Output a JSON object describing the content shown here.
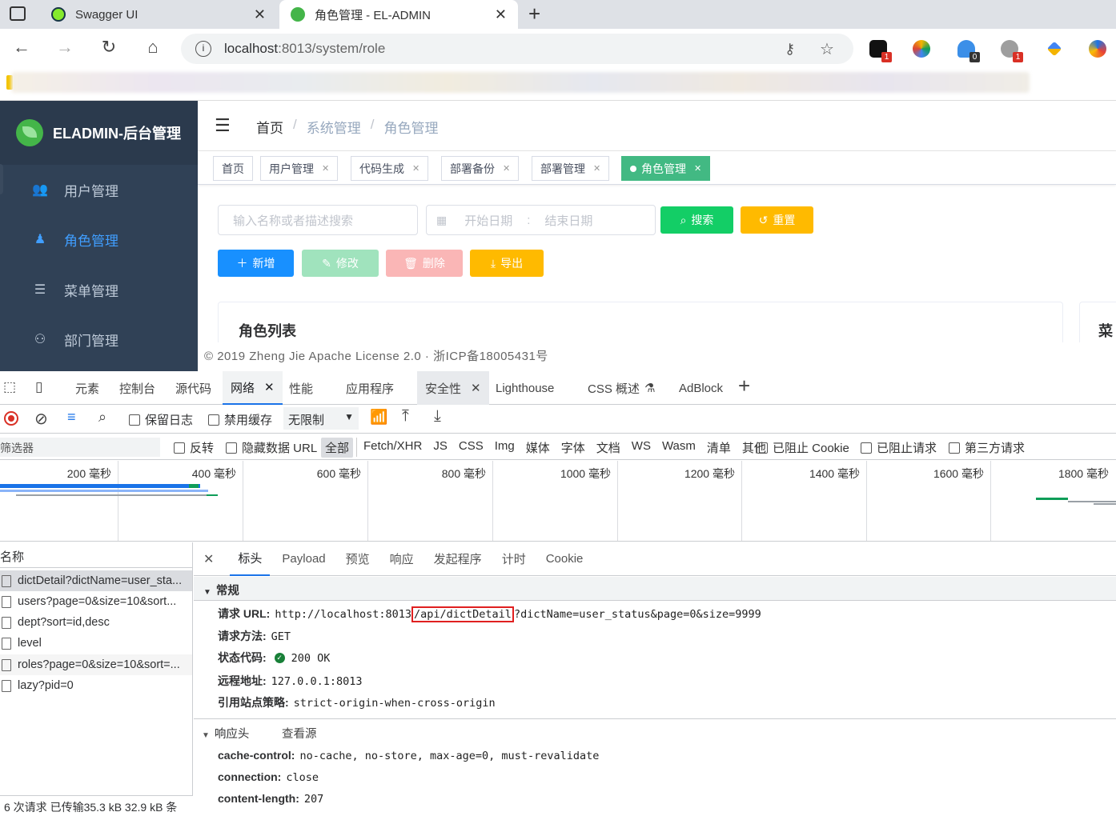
{
  "browser": {
    "tabs": [
      {
        "title": "Swagger UI"
      },
      {
        "title": "角色管理 - EL-ADMIN"
      }
    ],
    "url_host": "localhost",
    "url_path": ":8013/system/role",
    "extension_badges": [
      "1",
      "0",
      "1"
    ]
  },
  "app": {
    "logo_text": "ELADMIN-后台管理",
    "menu": [
      {
        "label": "用户管理"
      },
      {
        "label": "角色管理"
      },
      {
        "label": "菜单管理"
      },
      {
        "label": "部门管理"
      }
    ],
    "breadcrumb": [
      "首页",
      "系统管理",
      "角色管理"
    ],
    "tags": [
      "首页",
      "用户管理",
      "代码生成",
      "部署备份",
      "部署管理",
      "角色管理"
    ],
    "search_placeholder": "输入名称或者描述搜索",
    "start_date": "开始日期",
    "date_sep": ":",
    "end_date": "结束日期",
    "btn_search": "搜索",
    "btn_reset": "重置",
    "btn_add": "新增",
    "btn_edit": "修改",
    "btn_delete": "删除",
    "btn_export": "导出",
    "card_title": "角色列表",
    "card2_title": "菜",
    "footer": "© 2019 Zheng Jie Apache License 2.0 · 浙ICP备18005431号"
  },
  "devtools": {
    "tabs": [
      "元素",
      "控制台",
      "源代码",
      "网络",
      "性能",
      "应用程序",
      "安全性",
      "Lighthouse",
      "CSS 概述",
      "AdBlock"
    ],
    "toolbar": {
      "preserve_log": "保留日志",
      "disable_cache": "禁用缓存",
      "throttle": "无限制"
    },
    "filter": {
      "placeholder": "筛选器",
      "invert": "反转",
      "hide_data": "隐藏数据 URL",
      "all": "全部",
      "types": [
        "Fetch/XHR",
        "JS",
        "CSS",
        "Img",
        "媒体",
        "字体",
        "文档",
        "WS",
        "Wasm",
        "清单",
        "其他"
      ],
      "blocked_cookie": "已阻止 Cookie",
      "blocked_req": "已阻止请求",
      "third_party": "第三方请求"
    },
    "timeline_ticks": [
      "200 毫秒",
      "400 毫秒",
      "600 毫秒",
      "800 毫秒",
      "1000 毫秒",
      "1200 毫秒",
      "1400 毫秒",
      "1600 毫秒",
      "1800 毫秒"
    ],
    "name_header": "名称",
    "requests": [
      "dictDetail?dictName=user_sta...",
      "users?page=0&size=10&sort...",
      "dept?sort=id,desc",
      "level",
      "roles?page=0&size=10&sort=...",
      "lazy?pid=0"
    ],
    "status_bar": "6 次请求  已传输35.3 kB  32.9 kB 条",
    "panel_tabs": [
      "标头",
      "Payload",
      "预览",
      "响应",
      "发起程序",
      "计时",
      "Cookie"
    ],
    "general_title": "常规",
    "general": {
      "url_label": "请求 URL:",
      "url_pre": "http://localhost:8013",
      "url_hl": "/api/dictDetail",
      "url_post": "?dictName=user_status&page=0&size=9999",
      "method_label": "请求方法:",
      "method": "GET",
      "status_label": "状态代码:",
      "status": "200 OK",
      "remote_label": "远程地址:",
      "remote": "127.0.0.1:8013",
      "referrer_label": "引用站点策略:",
      "referrer": "strict-origin-when-cross-origin"
    },
    "response_title": "响应头",
    "view_source": "查看源",
    "response_headers": [
      {
        "k": "cache-control:",
        "v": "no-cache, no-store, max-age=0, must-revalidate"
      },
      {
        "k": "connection:",
        "v": "close"
      },
      {
        "k": "content-length:",
        "v": "207"
      }
    ]
  }
}
